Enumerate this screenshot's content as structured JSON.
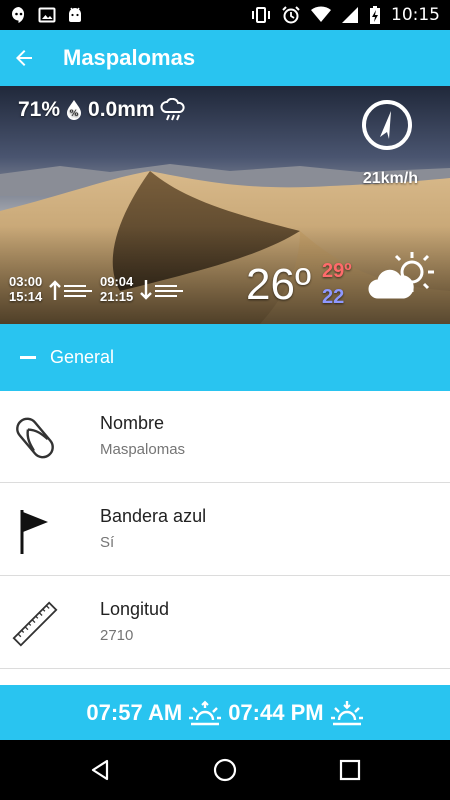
{
  "status_bar": {
    "time": "10:15",
    "left_icons": [
      "hangouts-icon",
      "image-icon",
      "android-icon"
    ],
    "right_icons": [
      "vibrate-icon",
      "alarm-icon",
      "wifi-icon",
      "signal-icon",
      "battery-charging-icon"
    ]
  },
  "app_bar": {
    "title": "Maspalomas",
    "back_icon": "arrow-back-icon"
  },
  "hero": {
    "humidity": "71%",
    "rain": "0.0mm",
    "wind_speed": "21km/h",
    "tide_high_1": "03:00",
    "tide_high_2": "15:14",
    "tide_low_1": "09:04",
    "tide_low_2": "21:15",
    "temperature": "26º",
    "temp_max": "29º",
    "temp_min": "22",
    "weather_icon": "partly-cloudy-icon"
  },
  "section": {
    "label": "General"
  },
  "items": [
    {
      "title": "Nombre",
      "value": "Maspalomas",
      "icon": "flip-flop-icon"
    },
    {
      "title": "Bandera azul",
      "value": "Sí",
      "icon": "flag-icon"
    },
    {
      "title": "Longitud",
      "value": "2710",
      "icon": "ruler-icon"
    }
  ],
  "sun": {
    "sunrise": "07:57 AM",
    "sunset": "07:44 PM"
  },
  "colors": {
    "accent": "#29c4f0",
    "temp_max": "#ff6b6b",
    "temp_min": "#8e98ff"
  }
}
